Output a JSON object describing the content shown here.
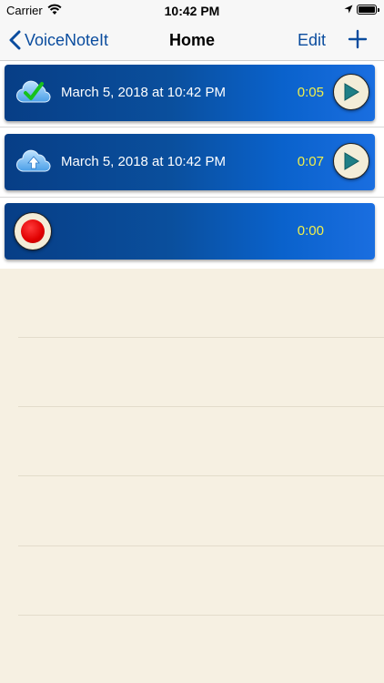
{
  "status_bar": {
    "carrier": "Carrier",
    "time": "10:42 PM"
  },
  "nav": {
    "back_label": "VoiceNoteIt",
    "title": "Home",
    "edit_label": "Edit"
  },
  "recordings": [
    {
      "date": "March 5, 2018 at 10:42 PM",
      "duration": "0:05",
      "cloud_status": "synced-check-icon"
    },
    {
      "date": "March 5, 2018 at 10:42 PM",
      "duration": "0:07",
      "cloud_status": "upload-arrow-icon"
    }
  ],
  "recorder": {
    "duration": "0:00"
  },
  "colors": {
    "accent": "#0a4c9e",
    "row_gradient_start": "#073e86",
    "row_gradient_end": "#1a6ee0",
    "duration_text": "#f2f04a",
    "background": "#f6f0e2",
    "record": "#e00000"
  }
}
